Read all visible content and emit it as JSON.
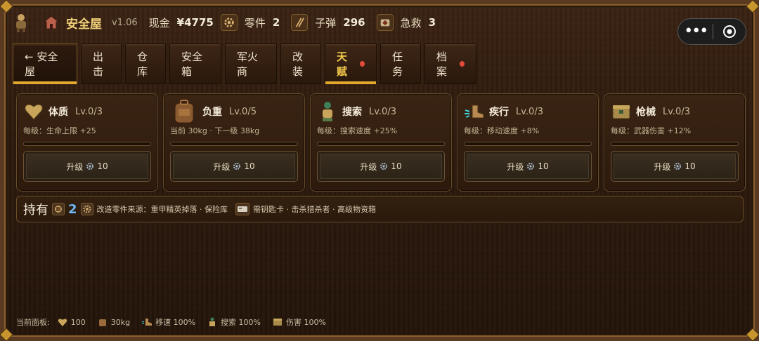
{
  "topbar": {
    "title": "安全屋",
    "version": "v1.06",
    "cash_label": "现金",
    "cash_value": "¥4775",
    "parts_label": "零件",
    "parts_value": "2",
    "ammo_label": "子弹",
    "ammo_value": "296",
    "aid_label": "急救",
    "aid_value": "3"
  },
  "capsule": {
    "more": "•••"
  },
  "tabs": [
    {
      "label": "← 安全屋",
      "state": "home"
    },
    {
      "label": "出击"
    },
    {
      "label": "仓库"
    },
    {
      "label": "安全箱"
    },
    {
      "label": "军火商"
    },
    {
      "label": "改装"
    },
    {
      "label": "天赋",
      "state": "active",
      "dot": true
    },
    {
      "label": "任务"
    },
    {
      "label": "档案",
      "dot": true
    }
  ],
  "talents": [
    {
      "name": "体质",
      "level": "Lv.0/3",
      "desc": "每级：生命上限 +25",
      "btn": "升级",
      "cost": "10",
      "progress": 0,
      "icon": "heart-icon"
    },
    {
      "name": "负重",
      "level": "Lv.0/5",
      "desc": "当前 30kg · 下一级 38kg",
      "btn": "升级",
      "cost": "10",
      "progress": 0,
      "icon": "backpack-icon"
    },
    {
      "name": "搜索",
      "level": "Lv.0/3",
      "desc": "每级：搜索速度 +25%",
      "btn": "升级",
      "cost": "10",
      "progress": 0,
      "icon": "search-figure-icon"
    },
    {
      "name": "疾行",
      "level": "Lv.0/3",
      "desc": "每级：移动速度 +8%",
      "btn": "升级",
      "cost": "10",
      "progress": 0,
      "icon": "boot-icon"
    },
    {
      "name": "枪械",
      "level": "Lv.0/3",
      "desc": "每级：武器伤害 +12%",
      "btn": "升级",
      "cost": "10",
      "progress": 0,
      "icon": "weapon-crate-icon"
    }
  ],
  "holdings": {
    "label": "持有",
    "count": "2",
    "source_text": "改造零件来源：重甲精英掉落 · 保险库",
    "key_text": "需钥匙卡 · 击杀猎杀者 · 高级物资箱"
  },
  "status": {
    "label": "当前面板:",
    "hp": "100",
    "weight": "30kg",
    "speed": "移速 100%",
    "search": "搜索 100%",
    "damage": "伤害 100%"
  },
  "colors": {
    "accent": "#e4a82c",
    "title": "#f2d27a",
    "count_blue": "#6fb6f2",
    "dot_red": "#e24b3b"
  }
}
